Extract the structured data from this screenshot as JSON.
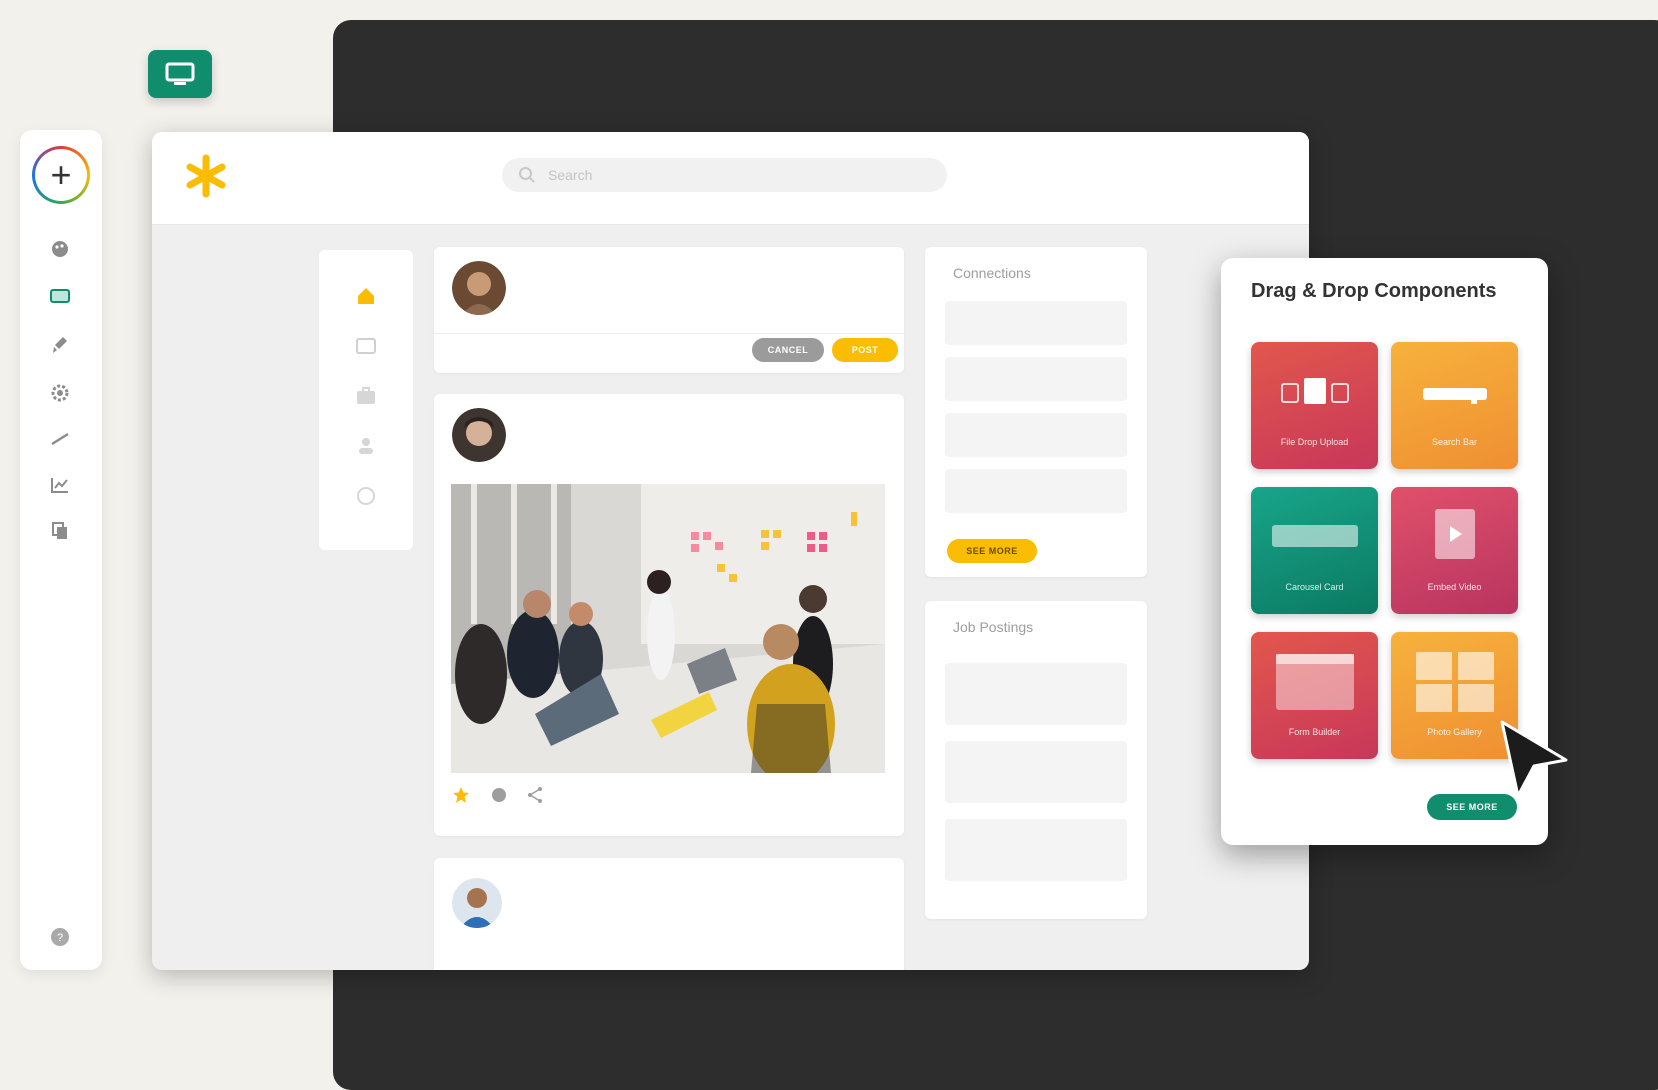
{
  "colors": {
    "background": "#f3f1ec",
    "dark_panel": "#2d2d2d",
    "accent_teal": "#0f8d6c",
    "accent_yellow": "#fbbc04",
    "tile_red": "#d63d4f",
    "tile_orange": "#f6a43a"
  },
  "rail": {
    "add_icon": "plus-icon",
    "help_icon": "help-icon"
  },
  "app": {
    "search_placeholder": "Search",
    "post1": {
      "pill_gray": "CANCEL",
      "pill_yellow": "POST"
    },
    "side_cards": {
      "connections_title": "Connections",
      "see_more": "SEE MORE",
      "job_postings_title": "Job Postings"
    }
  },
  "drag_drop": {
    "title": "Drag & Drop Components",
    "tiles": [
      {
        "label": "File Drop Upload"
      },
      {
        "label": "Search Bar"
      },
      {
        "label": "Carousel Card"
      },
      {
        "label": "Embed Video"
      },
      {
        "label": "Form Builder"
      },
      {
        "label": "Photo Gallery"
      }
    ],
    "see_more": "SEE MORE"
  }
}
